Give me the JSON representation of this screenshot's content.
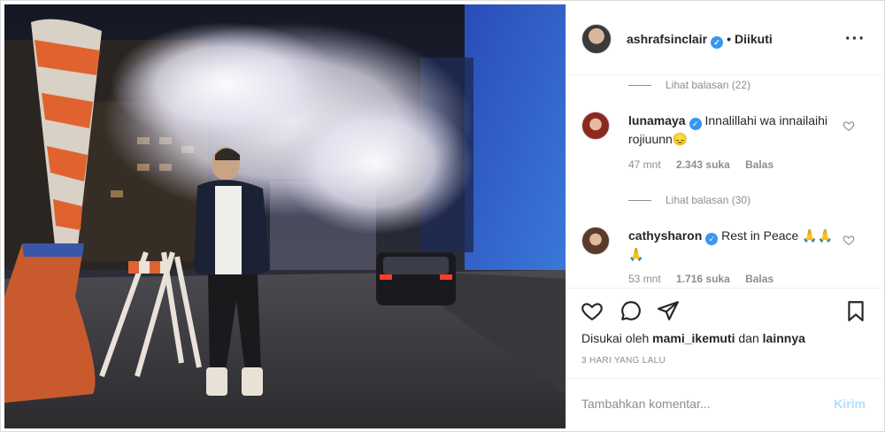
{
  "post": {
    "image_alt": "Man walking on night city street with steam plume"
  },
  "header": {
    "username": "ashrafsinclair",
    "verified_icon": "verified-badge-icon",
    "separator": "•",
    "follow_status": "Diikuti",
    "more_icon": "more-options-icon"
  },
  "comments": {
    "reply_toggle_1": "Lihat balasan (22)",
    "items": [
      {
        "username": "lunamaya",
        "text": "Innalillahi wa innailaihi rojiuunn😞",
        "time": "47 mnt",
        "likes": "2.343 suka",
        "reply": "Balas"
      },
      {
        "username": "cathysharon",
        "text": "Rest in Peace 🙏🙏🙏",
        "time": "53 mnt",
        "likes": "1.716 suka",
        "reply": "Balas"
      }
    ],
    "reply_toggle_2": "Lihat balasan (30)"
  },
  "actions": {
    "liked_by_prefix": "Disukai oleh",
    "liked_by_user": "mami_ikemuti",
    "liked_by_and": "dan",
    "liked_by_others": "lainnya",
    "timestamp": "3 HARI YANG LALU"
  },
  "add_comment": {
    "placeholder": "Tambahkan komentar...",
    "post_label": "Kirim"
  },
  "colors": {
    "verified": "#3897f0",
    "muted_text": "#8e8e8e",
    "post_button": "#b2dffc"
  }
}
